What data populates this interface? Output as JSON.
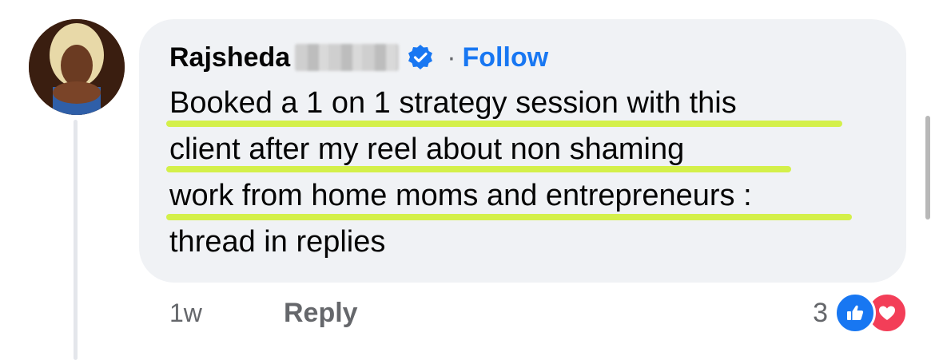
{
  "comment": {
    "author": "Rajsheda",
    "separator": "·",
    "follow_label": "Follow",
    "lines": [
      "Booked a 1 on 1 strategy session with this",
      "client after my reel about non shaming",
      "work from home moms and entrepreneurs :",
      "thread in replies"
    ],
    "time": "1w",
    "reply_label": "Reply",
    "reaction_count": "3"
  },
  "icons": {
    "verified": "verified-badge-icon",
    "like": "like-reaction-icon",
    "love": "love-reaction-icon"
  },
  "colors": {
    "accent": "#1877f2",
    "bubble": "#f0f2f5",
    "highlight": "#d4f04a",
    "love": "#f33e58"
  }
}
